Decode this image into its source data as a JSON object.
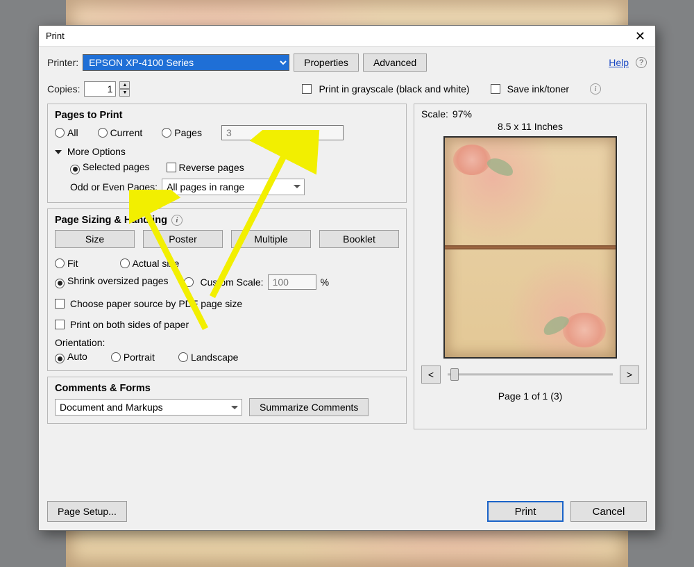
{
  "window": {
    "title": "Print"
  },
  "toolbar": {
    "printer_label": "Printer:",
    "printer_value": "EPSON XP-4100 Series",
    "properties": "Properties",
    "advanced": "Advanced",
    "help": "Help"
  },
  "copies": {
    "label": "Copies:",
    "value": "1",
    "grayscale": "Print in grayscale (black and white)",
    "save_ink": "Save ink/toner"
  },
  "pages_to_print": {
    "heading": "Pages to Print",
    "all": "All",
    "current": "Current",
    "pages": "Pages",
    "pages_value": "3",
    "more_options": "More Options",
    "selected_pages": "Selected pages",
    "reverse_pages": "Reverse pages",
    "odd_even_label": "Odd or Even Pages:",
    "odd_even_value": "All pages in range"
  },
  "sizing": {
    "heading": "Page Sizing & Handling",
    "size": "Size",
    "poster": "Poster",
    "multiple": "Multiple",
    "booklet": "Booklet",
    "fit": "Fit",
    "actual": "Actual size",
    "shrink": "Shrink oversized pages",
    "custom": "Custom Scale:",
    "custom_value": "100",
    "percent": "%",
    "choose_source": "Choose paper source by PDF page size",
    "duplex": "Print on both sides of paper",
    "orientation_label": "Orientation:",
    "auto": "Auto",
    "portrait": "Portrait",
    "landscape": "Landscape"
  },
  "comments": {
    "heading": "Comments & Forms",
    "value": "Document and Markups",
    "summarize": "Summarize Comments"
  },
  "preview": {
    "scale_label": "Scale:",
    "scale_value": "97%",
    "paper_size": "8.5 x 11 Inches",
    "prev": "<",
    "next": ">",
    "page_of": "Page 1 of 1 (3)"
  },
  "footer": {
    "page_setup": "Page Setup...",
    "print": "Print",
    "cancel": "Cancel"
  }
}
